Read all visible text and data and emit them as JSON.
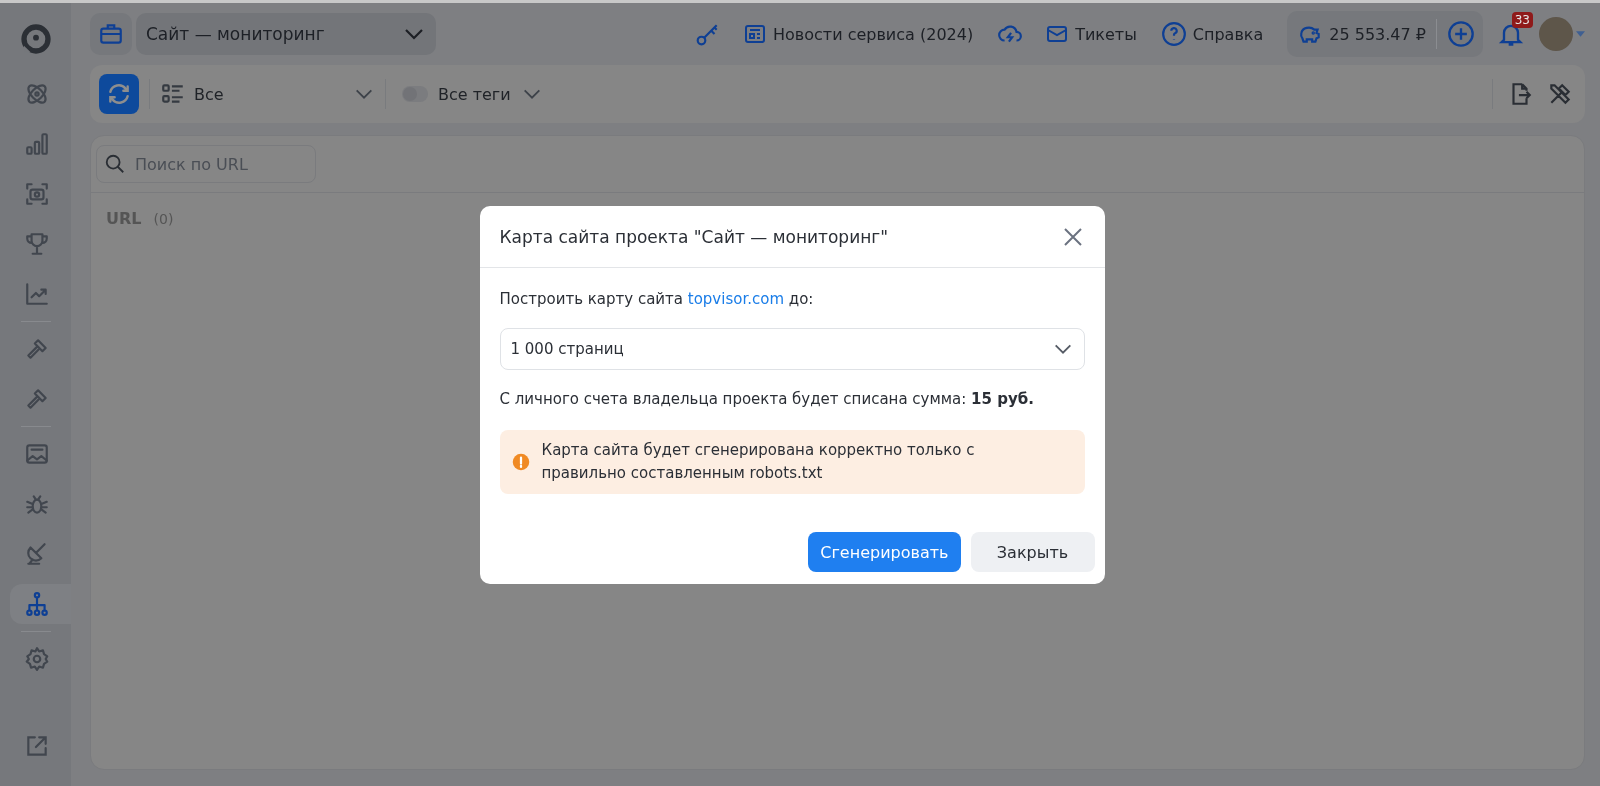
{
  "sidebar": {
    "groups": [
      [
        {
          "selected": false
        },
        {
          "selected": false
        },
        {
          "selected": false
        },
        {
          "selected": false
        },
        {
          "selected": false
        }
      ],
      [
        {
          "selected": false
        },
        {
          "selected": false
        }
      ],
      [
        {
          "selected": false
        },
        {
          "selected": false
        },
        {
          "selected": false
        },
        {
          "selected": true
        }
      ],
      [
        {
          "selected": false
        }
      ]
    ],
    "bottom": [
      {
        "selected": false
      }
    ]
  },
  "header": {
    "project": "Сайт — мониторинг",
    "news": "Новости сервиса (2024)",
    "tickets": "Тикеты",
    "help": "Справка",
    "balance": "25 553.47 ₽",
    "notifications": "33"
  },
  "toolbar": {
    "filter": "Все",
    "tags": {
      "label": "Все теги",
      "on": false
    }
  },
  "search": {
    "placeholder": "Поиск по URL"
  },
  "table": {
    "columns": [
      {
        "label": "URL",
        "count": "(0)"
      }
    ]
  },
  "dialog": {
    "title": "Карта сайта проекта \"Сайт — мониторинг\"",
    "intro": {
      "before": "Построить карту сайта ",
      "link": "topvisor.com",
      "after": " до:"
    },
    "select": {
      "value": "1 000 страниц"
    },
    "cost": "С личного счета владельца проекта будет списана сумма: **15 руб.**",
    "warning": "Карта сайта будет сгенерирована корректно только с правильно составленным robots.txt",
    "buttons": [
      {
        "label": "Сгенерировать",
        "kind": "primary"
      },
      {
        "label": "Закрыть",
        "kind": "secondary"
      }
    ]
  }
}
